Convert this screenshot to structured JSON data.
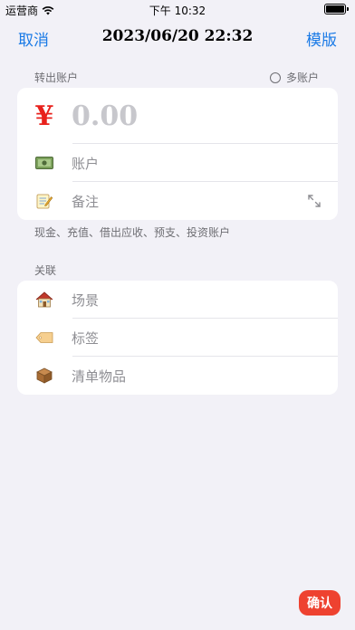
{
  "status_bar": {
    "carrier": "运营商",
    "time": "下午 10:32"
  },
  "nav": {
    "cancel_label": "取消",
    "title": "2023/06/20  22:32",
    "template_label": "模版"
  },
  "transfer_out": {
    "header": "转出账户",
    "multi_account_label": "多账户",
    "currency_symbol": "¥",
    "amount": "0.00",
    "account_placeholder": "账户",
    "note_placeholder": "备注",
    "hint": "现金、充值、借出应收、预支、投资账户"
  },
  "related": {
    "header": "关联",
    "items": [
      {
        "label": "场景",
        "icon": "house-icon"
      },
      {
        "label": "标签",
        "icon": "tag-icon"
      },
      {
        "label": "清单物品",
        "icon": "package-icon"
      }
    ]
  },
  "confirm_label": "确认",
  "colors": {
    "accent": "#1a7ae6",
    "currency": "#e8211c",
    "confirm": "#ee4230",
    "background": "#f2f1f7"
  }
}
